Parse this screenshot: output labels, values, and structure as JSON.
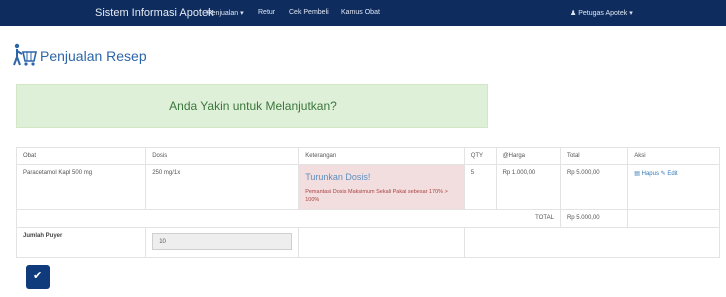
{
  "navbar": {
    "brand": "Sistem Informasi Apotek",
    "links": [
      "Penjualan ▾",
      "Retur",
      "Cek Pembeli",
      "Kamus Obat"
    ],
    "user": "♟ Petugas Apotek ▾"
  },
  "page": {
    "title": "Penjualan Resep"
  },
  "alert": {
    "text": "Anda Yakin untuk Melanjutkan?"
  },
  "table": {
    "headers": [
      "Obat",
      "Dosis",
      "Keterangan",
      "QTY",
      "@Harga",
      "Total",
      "Aksi"
    ],
    "rows": [
      {
        "obat": "Paracetamol Kapl 500 mg",
        "dosis": "250 mg/1x",
        "warning_title": "Turunkan Dosis!",
        "warning_desc": "Pemantasi Dosis Maksimum Sekali Pakai sebesar 170% > 100%",
        "qty": "5",
        "harga": "Rp 1.000,00",
        "total": "Rp 5.000,00",
        "hapus": "▤ Hapus",
        "edit": "✎ Edit"
      }
    ],
    "total_label": "TOTAL",
    "total_value": "Rp 5.000,00"
  },
  "puyer": {
    "label": "Jumlah Puyer",
    "value": "10"
  },
  "submit": {
    "icon": "✔"
  }
}
